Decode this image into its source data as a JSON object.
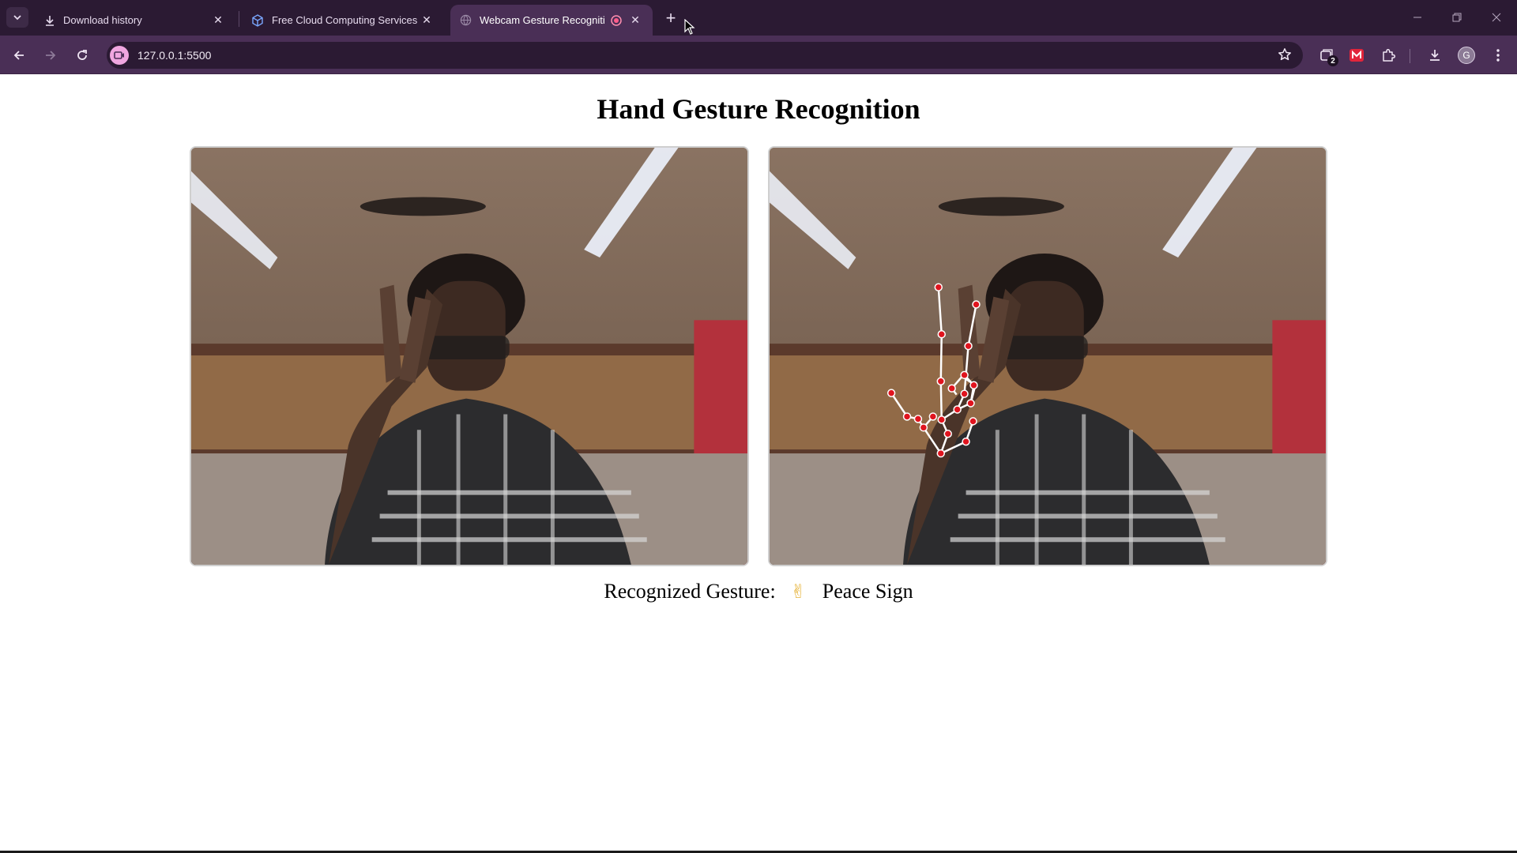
{
  "browser": {
    "tabs": [
      {
        "title": "Download history",
        "icon": "download-icon"
      },
      {
        "title": "Free Cloud Computing Services",
        "icon": "cube-icon"
      },
      {
        "title": "Webcam Gesture Recogniti",
        "icon": "globe-icon",
        "recording": true,
        "active": true
      }
    ],
    "address": "127.0.0.1:5500",
    "extension_badge_count": "2",
    "profile_initial": "G",
    "colors": {
      "frame": "#2b1a33",
      "toolbar": "#4a2f56",
      "site_chip": "#f0a6e0"
    }
  },
  "page": {
    "title": "Hand Gesture Recognition",
    "panels": [
      {
        "name": "raw-webcam-feed",
        "landmarks_overlay": false
      },
      {
        "name": "annotated-webcam-feed",
        "landmarks_overlay": true
      }
    ],
    "gesture": {
      "label": "Recognized Gesture:",
      "emoji": "✌",
      "value": "Peace Sign"
    },
    "colors": {
      "landmark_point": "#e0141e",
      "landmark_line": "#ffffff"
    }
  }
}
